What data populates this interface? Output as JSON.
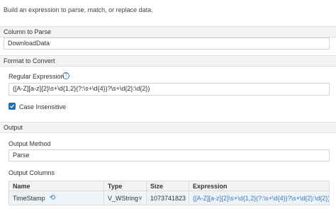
{
  "description": "Build an expression to parse, match, or replace data.",
  "column_to_parse": {
    "title": "Column to Parse",
    "value": "DownloadData"
  },
  "format_to_convert": {
    "title": "Format to Convert",
    "regex_label": "Regular Expression",
    "regex_value": "([A-Z][a-z]{2}\\s+\\d{1,2}(?:\\s+\\d{4})?\\s+\\d{2}:\\d{2})",
    "case_insensitive_label": "Case Insensitive",
    "case_insensitive_checked": true
  },
  "output": {
    "title": "Output",
    "method_label": "Output Method",
    "method_value": "Parse",
    "columns_label": "Output Columns",
    "table": {
      "headers": [
        "Name",
        "Type",
        "Size",
        "Expression"
      ],
      "rows": [
        {
          "name": "TimeStamp",
          "type": "V_WString",
          "size": "1073741823",
          "expression": "([A-Z][a-z]{2}\\s+\\d{1,2}(?:\\s+\\d{4})?\\s+\\d{2}:\\d{2})"
        }
      ]
    }
  },
  "icons": {
    "help": "help-icon",
    "checkbox": "checkmark-icon",
    "reset": "reset-icon",
    "dropdown": "chevron-down-icon"
  },
  "colors": {
    "accent": "#1f6fb2",
    "link": "#3a7bbf",
    "section_bg": "#f3f3f3",
    "row_bg": "#eef3f8"
  }
}
